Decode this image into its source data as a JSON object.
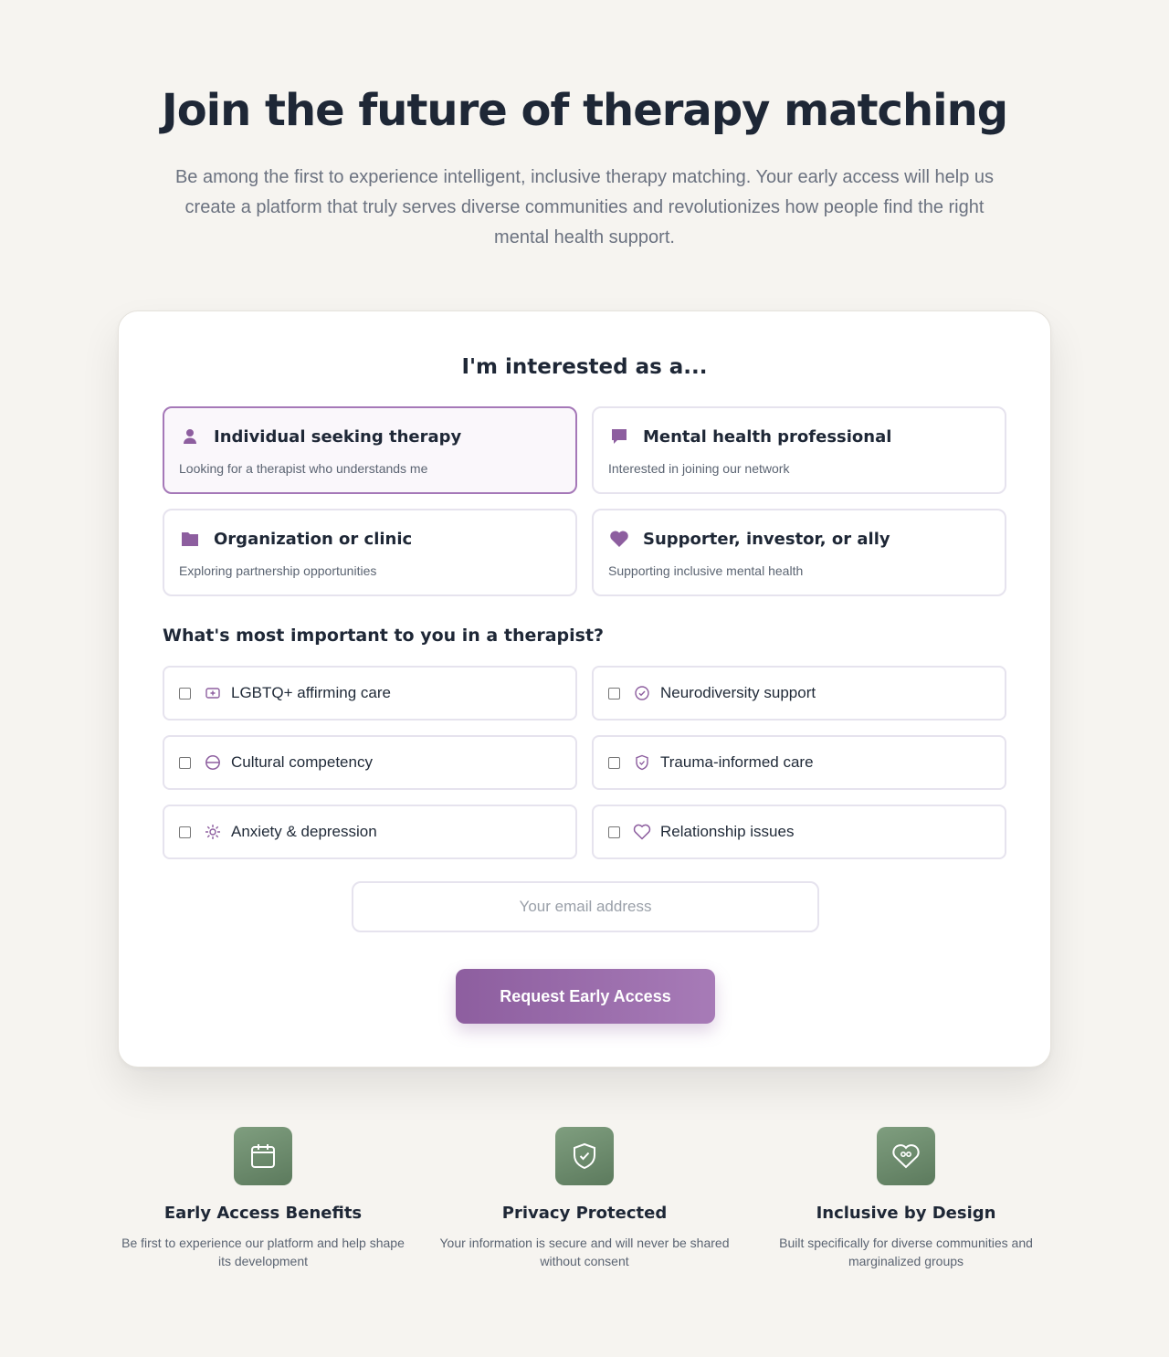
{
  "hero": {
    "title": "Join the future of therapy matching",
    "subtitle": "Be among the first to experience intelligent, inclusive therapy matching. Your early access will help us create a platform that truly serves diverse communities and revolutionizes how people find the right mental health support."
  },
  "form": {
    "role_heading": "I'm interested as a...",
    "roles": [
      {
        "icon": "person-icon",
        "title": "Individual seeking therapy",
        "description": "Looking for a therapist who understands me",
        "selected": true
      },
      {
        "icon": "chat-bubble-icon",
        "title": "Mental health professional",
        "description": "Interested in joining our network",
        "selected": false
      },
      {
        "icon": "folder-icon",
        "title": "Organization or clinic",
        "description": "Exploring partnership opportunities",
        "selected": false
      },
      {
        "icon": "heart-icon",
        "title": "Supporter, investor, or ally",
        "description": "Supporting inclusive mental health",
        "selected": false
      }
    ],
    "preferences_heading": "What's most important to you in a therapist?",
    "preferences": [
      {
        "icon": "badge-icon",
        "label": "LGBTQ+ affirming care",
        "checked": false
      },
      {
        "icon": "check-circle-icon",
        "label": "Neurodiversity support",
        "checked": false
      },
      {
        "icon": "globe-icon",
        "label": "Cultural competency",
        "checked": false
      },
      {
        "icon": "shield-icon",
        "label": "Trauma-informed care",
        "checked": false
      },
      {
        "icon": "sun-icon",
        "label": "Anxiety & depression",
        "checked": false
      },
      {
        "icon": "heart-outline-icon",
        "label": "Relationship issues",
        "checked": false
      }
    ],
    "email": {
      "value": "",
      "placeholder": "Your email address"
    },
    "submit_label": "Request Early Access"
  },
  "features": [
    {
      "icon": "calendar-icon",
      "title": "Early Access Benefits",
      "description": "Be first to experience our platform and help shape its development"
    },
    {
      "icon": "shield-check-icon",
      "title": "Privacy Protected",
      "description": "Your information is secure and will never be shared without consent"
    },
    {
      "icon": "heart-handshake-icon",
      "title": "Inclusive by Design",
      "description": "Built specifically for diverse communities and marginalized groups"
    }
  ],
  "colors": {
    "accent": "#8d5e9f",
    "accent_light": "#a77bb7",
    "feature_green": "#6b8b6c",
    "background": "#f6f4f0"
  }
}
